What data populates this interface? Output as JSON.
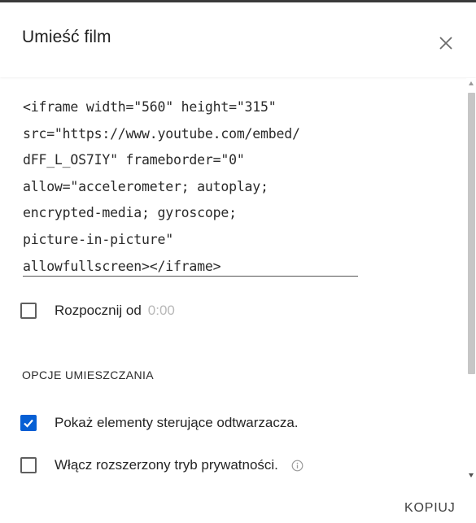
{
  "dialog": {
    "title": "Umieść film",
    "close_icon": "close-icon"
  },
  "embed_code": {
    "lines": [
      "<iframe width=\"560\" height=\"315\"",
      "src=\"https://www.youtube.com/embed/",
      "dFF_L_OS7IY\" frameborder=\"0\"",
      "allow=\"accelerometer; autoplay;",
      "encrypted-media; gyroscope;",
      "picture-in-picture\"",
      "allowfullscreen></iframe>"
    ]
  },
  "start_at": {
    "label": "Rozpocznij od",
    "time": "0:00",
    "checked": false
  },
  "options": {
    "heading": "OPCJE UMIESZCZANIA",
    "items": [
      {
        "label": "Pokaż elementy sterujące odtwarzacza.",
        "checked": true
      },
      {
        "label": "Włącz rozszerzony tryb prywatności.",
        "checked": false,
        "info_icon": "info-icon"
      }
    ]
  },
  "footer": {
    "copy_label": "KOPIUJ"
  },
  "colors": {
    "accent": "#065fd4",
    "text": "#212121",
    "muted": "#b8b8b8"
  }
}
